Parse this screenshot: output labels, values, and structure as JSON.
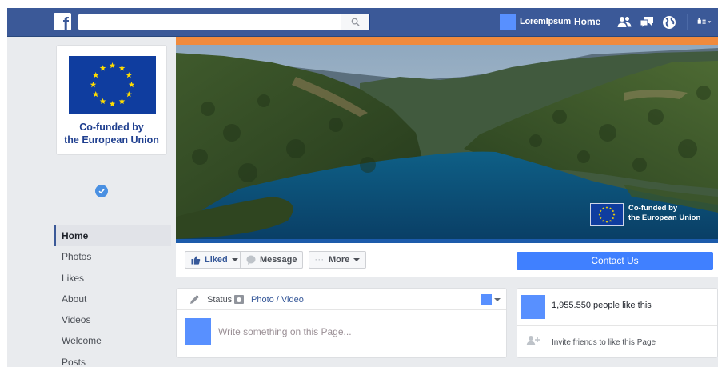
{
  "colors": {
    "brand": "#3b5998",
    "accent": "#4080ff",
    "orange_strip": "#f08a3c",
    "eu_blue": "#0f3d9f",
    "eu_star": "#ffdd00"
  },
  "header": {
    "logo": "f",
    "search": {
      "value": "",
      "placeholder": ""
    },
    "search_icon": "search-icon",
    "profile_name": "LoremIpsum",
    "home_label": "Home",
    "icons": [
      "friend-requests-icon",
      "messages-icon",
      "globe-icon",
      "settings-menu-icon"
    ]
  },
  "eu_badge": {
    "line1": "Co-funded by",
    "line2": "the European Union"
  },
  "sidebar": {
    "items": [
      {
        "label": "Home",
        "active": true
      },
      {
        "label": "Photos"
      },
      {
        "label": "Likes"
      },
      {
        "label": "About"
      },
      {
        "label": "Videos"
      },
      {
        "label": "Welcome"
      },
      {
        "label": "Posts"
      }
    ]
  },
  "cover": {
    "eu_line1": "Co-funded by",
    "eu_line2": "the European Union"
  },
  "actions": {
    "liked_label": "Liked",
    "message_label": "Message",
    "more_label": "More",
    "contact_label": "Contact Us"
  },
  "composer": {
    "status_label": "Status",
    "photo_label": "Photo / Video",
    "placeholder": "Write something on this Page..."
  },
  "likes": {
    "count_text": "1,955.550 people like this",
    "invite_text": "Invite friends to like this Page"
  }
}
